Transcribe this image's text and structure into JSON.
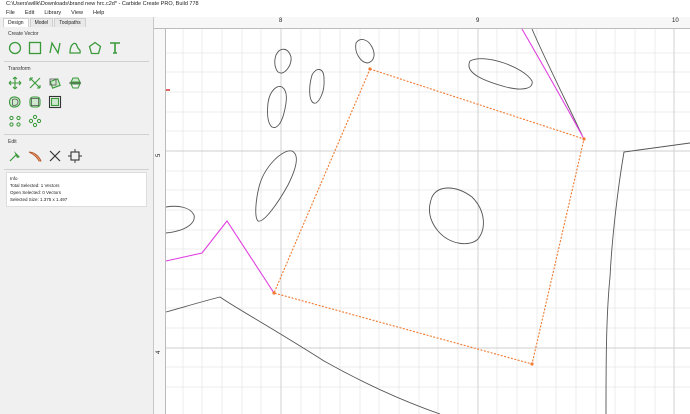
{
  "window": {
    "title": "C:\\Users\\willk\\Downloads\\brand new hrc.c2d* - Carbide Create PRO, Build 778"
  },
  "menu": [
    "File",
    "Edit",
    "Library",
    "View",
    "Help"
  ],
  "sidebar": {
    "tabs": [
      "Design",
      "Model",
      "Toolpaths"
    ],
    "active_tab": "Design",
    "create_vector": {
      "title": "Create Vector",
      "tools": [
        "circle-icon",
        "rectangle-icon",
        "polyline-icon",
        "curve-icon",
        "polygon-icon",
        "text-icon"
      ]
    },
    "transform": {
      "title": "Transform",
      "tools": [
        "move-icon",
        "scale-icon",
        "rotate-icon",
        "mirror-icon",
        "offset-icon",
        "fillet-icon",
        "boolean-icon",
        "align-icon",
        "circular-array-icon",
        "linear-array-icon"
      ]
    },
    "edit": {
      "title": "Edit",
      "tools": [
        "node-edit-icon",
        "knife-icon",
        "trim-icon",
        "boundary-icon"
      ]
    },
    "info": {
      "title": "Info",
      "total_selected": "Total Selected:   1 Vectors",
      "open_selected": "Open Selected:   0 Vectors",
      "selected_size": "Selected Size:    1.375 x 1.497"
    }
  },
  "rulers": {
    "top_labels": [
      "8",
      "9",
      "10"
    ],
    "left_labels": [
      "5",
      "4"
    ]
  },
  "colors": {
    "selected_path": "#f07a30",
    "highlight_path": "#e040e0",
    "vector": "#555555",
    "grid": "#e6e6e6",
    "origin_marker": "#d00000"
  }
}
